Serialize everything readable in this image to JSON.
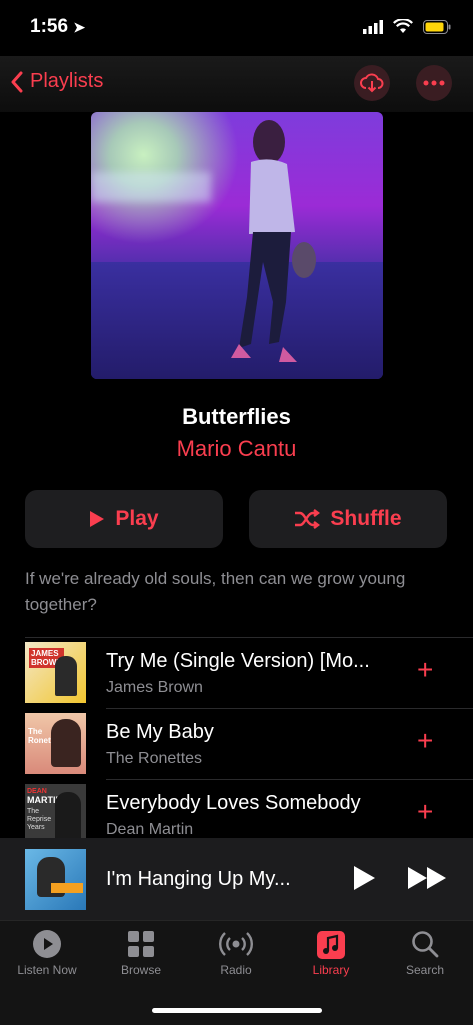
{
  "status": {
    "time": "1:56"
  },
  "nav": {
    "back_label": "Playlists"
  },
  "playlist": {
    "title": "Butterflies",
    "author": "Mario Cantu",
    "description": "If we're already old souls, then can we grow young together?"
  },
  "buttons": {
    "play": "Play",
    "shuffle": "Shuffle"
  },
  "tracks": [
    {
      "title": "Try Me (Single Version) [Mo...",
      "artist": "James Brown",
      "art_lines": [
        "JAMES",
        "BROWN"
      ]
    },
    {
      "title": "Be My Baby",
      "artist": "The Ronettes",
      "art_lines": [
        "The",
        "Ronettes"
      ]
    },
    {
      "title": "Everybody Loves Somebody",
      "artist": "Dean Martin",
      "art_lines": [
        "DEAN",
        "MARTIN",
        "The",
        "Reprise",
        "Years"
      ]
    }
  ],
  "now_playing": {
    "title": "I'm Hanging Up My..."
  },
  "tabs": [
    {
      "label": "Listen Now",
      "icon": "play-circle-icon"
    },
    {
      "label": "Browse",
      "icon": "grid-icon"
    },
    {
      "label": "Radio",
      "icon": "radio-waves-icon"
    },
    {
      "label": "Library",
      "icon": "music-note-icon",
      "active": true
    },
    {
      "label": "Search",
      "icon": "search-icon"
    }
  ],
  "colors": {
    "accent": "#fa3e4f",
    "secondary_text": "#8e8e93"
  }
}
